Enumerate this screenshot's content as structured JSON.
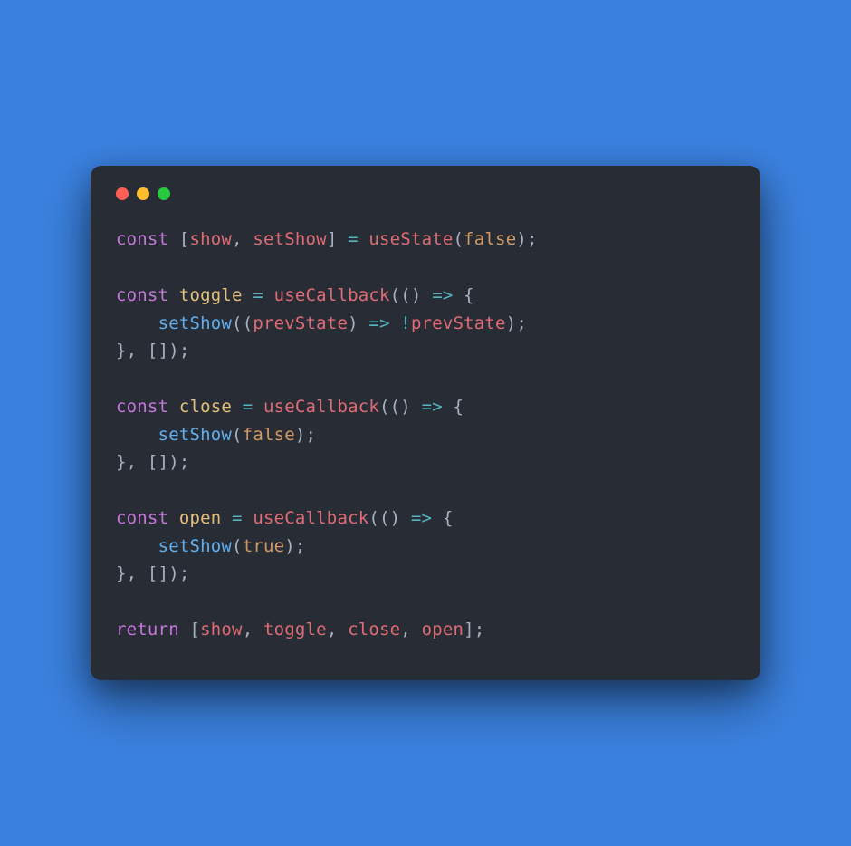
{
  "windowControls": {
    "red": "close",
    "yellow": "minimize",
    "green": "maximize"
  },
  "code": {
    "t": {
      "const": "const",
      "return": "return",
      "show": "show",
      "setShow": "setShow",
      "useState": "useState",
      "false": "false",
      "true": "true",
      "toggle": "toggle",
      "useCallback": "useCallback",
      "prevState": "prevState",
      "close": "close",
      "open": "open",
      "lbrack": "[",
      "rbrack": "]",
      "lparen": "(",
      "rparen": ")",
      "lbrace": "{",
      "rbrace": "}",
      "comma": ",",
      "semi": ";",
      "eq": "=",
      "arrow": "=>",
      "bang": "!",
      "sp": " ",
      "sp2": "  ",
      "sp4": "    "
    }
  }
}
